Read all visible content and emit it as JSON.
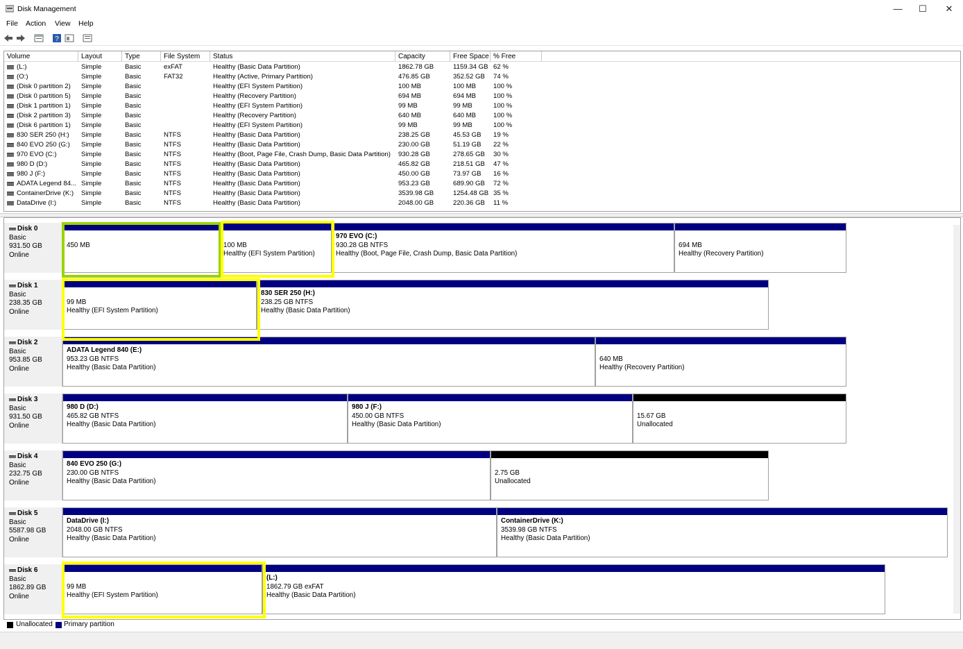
{
  "window": {
    "title": "Disk Management",
    "minimize": "—",
    "maximize": "☐",
    "close": "✕"
  },
  "menu": {
    "file": "File",
    "action": "Action",
    "view": "View",
    "help": "Help"
  },
  "toolbar": {
    "icons": [
      "back-icon",
      "forward-icon",
      "properties-icon",
      "help-icon",
      "console-icon",
      "export-icon"
    ]
  },
  "columns": {
    "volume": "Volume",
    "layout": "Layout",
    "type": "Type",
    "fs": "File System",
    "status": "Status",
    "capacity": "Capacity",
    "free": "Free Space",
    "pct": "% Free"
  },
  "volumes": [
    {
      "volume": "(L:)",
      "layout": "Simple",
      "type": "Basic",
      "fs": "exFAT",
      "status": "Healthy (Basic Data Partition)",
      "capacity": "1862.78 GB",
      "free": "1159.34 GB",
      "pct": "62 %"
    },
    {
      "volume": "(O:)",
      "layout": "Simple",
      "type": "Basic",
      "fs": "FAT32",
      "status": "Healthy (Active, Primary Partition)",
      "capacity": "476.85 GB",
      "free": "352.52 GB",
      "pct": "74 %"
    },
    {
      "volume": "(Disk 0 partition 2)",
      "layout": "Simple",
      "type": "Basic",
      "fs": "",
      "status": "Healthy (EFI System Partition)",
      "capacity": "100 MB",
      "free": "100 MB",
      "pct": "100 %"
    },
    {
      "volume": "(Disk 0 partition 5)",
      "layout": "Simple",
      "type": "Basic",
      "fs": "",
      "status": "Healthy (Recovery Partition)",
      "capacity": "694 MB",
      "free": "694 MB",
      "pct": "100 %"
    },
    {
      "volume": "(Disk 1 partition 1)",
      "layout": "Simple",
      "type": "Basic",
      "fs": "",
      "status": "Healthy (EFI System Partition)",
      "capacity": "99 MB",
      "free": "99 MB",
      "pct": "100 %"
    },
    {
      "volume": "(Disk 2 partition 3)",
      "layout": "Simple",
      "type": "Basic",
      "fs": "",
      "status": "Healthy (Recovery Partition)",
      "capacity": "640 MB",
      "free": "640 MB",
      "pct": "100 %"
    },
    {
      "volume": "(Disk 6 partition 1)",
      "layout": "Simple",
      "type": "Basic",
      "fs": "",
      "status": "Healthy (EFI System Partition)",
      "capacity": "99 MB",
      "free": "99 MB",
      "pct": "100 %"
    },
    {
      "volume": "830 SER 250 (H:)",
      "layout": "Simple",
      "type": "Basic",
      "fs": "NTFS",
      "status": "Healthy (Basic Data Partition)",
      "capacity": "238.25 GB",
      "free": "45.53 GB",
      "pct": "19 %"
    },
    {
      "volume": "840 EVO 250 (G:)",
      "layout": "Simple",
      "type": "Basic",
      "fs": "NTFS",
      "status": "Healthy (Basic Data Partition)",
      "capacity": "230.00 GB",
      "free": "51.19 GB",
      "pct": "22 %"
    },
    {
      "volume": "970 EVO (C:)",
      "layout": "Simple",
      "type": "Basic",
      "fs": "NTFS",
      "status": "Healthy (Boot, Page File, Crash Dump, Basic Data Partition)",
      "capacity": "930.28 GB",
      "free": "278.65 GB",
      "pct": "30 %"
    },
    {
      "volume": "980 D (D:)",
      "layout": "Simple",
      "type": "Basic",
      "fs": "NTFS",
      "status": "Healthy (Basic Data Partition)",
      "capacity": "465.82 GB",
      "free": "218.51 GB",
      "pct": "47 %"
    },
    {
      "volume": "980 J (F:)",
      "layout": "Simple",
      "type": "Basic",
      "fs": "NTFS",
      "status": "Healthy (Basic Data Partition)",
      "capacity": "450.00 GB",
      "free": "73.97 GB",
      "pct": "16 %"
    },
    {
      "volume": "ADATA Legend 84...",
      "layout": "Simple",
      "type": "Basic",
      "fs": "NTFS",
      "status": "Healthy (Basic Data Partition)",
      "capacity": "953.23 GB",
      "free": "689.90 GB",
      "pct": "72 %"
    },
    {
      "volume": "ContainerDrive (K:)",
      "layout": "Simple",
      "type": "Basic",
      "fs": "NTFS",
      "status": "Healthy (Basic Data Partition)",
      "capacity": "3539.98 GB",
      "free": "1254.48 GB",
      "pct": "35 %"
    },
    {
      "volume": "DataDrive (I:)",
      "layout": "Simple",
      "type": "Basic",
      "fs": "NTFS",
      "status": "Healthy (Basic Data Partition)",
      "capacity": "2048.00 GB",
      "free": "220.36 GB",
      "pct": "11 %"
    }
  ],
  "disks": [
    {
      "name": "Disk 0",
      "kind": "Basic",
      "size": "931.50 GB",
      "state": "Online",
      "parts": [
        {
          "title": "",
          "line1": "450 MB",
          "line2": "",
          "unalloc": false
        },
        {
          "title": "",
          "line1": "100 MB",
          "line2": "Healthy (EFI System Partition)",
          "unalloc": false
        },
        {
          "title": "970 EVO  (C:)",
          "line1": "930.28 GB NTFS",
          "line2": "Healthy (Boot, Page File, Crash Dump, Basic Data Partition)",
          "unalloc": false
        },
        {
          "title": "",
          "line1": "694 MB",
          "line2": "Healthy (Recovery Partition)",
          "unalloc": false
        }
      ]
    },
    {
      "name": "Disk 1",
      "kind": "Basic",
      "size": "238.35 GB",
      "state": "Online",
      "parts": [
        {
          "title": "",
          "line1": "99 MB",
          "line2": "Healthy (EFI System Partition)",
          "unalloc": false
        },
        {
          "title": "830 SER 250  (H:)",
          "line1": "238.25 GB NTFS",
          "line2": "Healthy (Basic Data Partition)",
          "unalloc": false
        }
      ]
    },
    {
      "name": "Disk 2",
      "kind": "Basic",
      "size": "953.85 GB",
      "state": "Online",
      "parts": [
        {
          "title": "ADATA Legend 840  (E:)",
          "line1": "953.23 GB NTFS",
          "line2": "Healthy (Basic Data Partition)",
          "unalloc": false
        },
        {
          "title": "",
          "line1": "640 MB",
          "line2": "Healthy (Recovery Partition)",
          "unalloc": false
        }
      ]
    },
    {
      "name": "Disk 3",
      "kind": "Basic",
      "size": "931.50 GB",
      "state": "Online",
      "parts": [
        {
          "title": "980 D  (D:)",
          "line1": "465.82 GB NTFS",
          "line2": "Healthy (Basic Data Partition)",
          "unalloc": false
        },
        {
          "title": "980 J  (F:)",
          "line1": "450.00 GB NTFS",
          "line2": "Healthy (Basic Data Partition)",
          "unalloc": false
        },
        {
          "title": "",
          "line1": "15.67 GB",
          "line2": "Unallocated",
          "unalloc": true
        }
      ]
    },
    {
      "name": "Disk 4",
      "kind": "Basic",
      "size": "232.75 GB",
      "state": "Online",
      "parts": [
        {
          "title": "840 EVO 250  (G:)",
          "line1": "230.00 GB NTFS",
          "line2": "Healthy (Basic Data Partition)",
          "unalloc": false
        },
        {
          "title": "",
          "line1": "2.75 GB",
          "line2": "Unallocated",
          "unalloc": true
        }
      ]
    },
    {
      "name": "Disk 5",
      "kind": "Basic",
      "size": "5587.98 GB",
      "state": "Online",
      "parts": [
        {
          "title": "DataDrive  (I:)",
          "line1": "2048.00 GB NTFS",
          "line2": "Healthy (Basic Data Partition)",
          "unalloc": false
        },
        {
          "title": "ContainerDrive  (K:)",
          "line1": "3539.98 GB NTFS",
          "line2": "Healthy (Basic Data Partition)",
          "unalloc": false
        }
      ]
    },
    {
      "name": "Disk 6",
      "kind": "Basic",
      "size": "1862.89 GB",
      "state": "Online",
      "parts": [
        {
          "title": "",
          "line1": "99 MB",
          "line2": "Healthy (EFI System Partition)",
          "unalloc": false
        },
        {
          "title": "(L:)",
          "line1": "1862.79 GB exFAT",
          "line2": "Healthy (Basic Data Partition)",
          "unalloc": false
        }
      ]
    }
  ],
  "legend": {
    "unallocated": "Unallocated",
    "primary": "Primary partition",
    "unalloc_color": "#000000",
    "primary_color": "#000080"
  },
  "highlight_colors": {
    "yellow": "#ffff00",
    "green": "#9ad400"
  }
}
